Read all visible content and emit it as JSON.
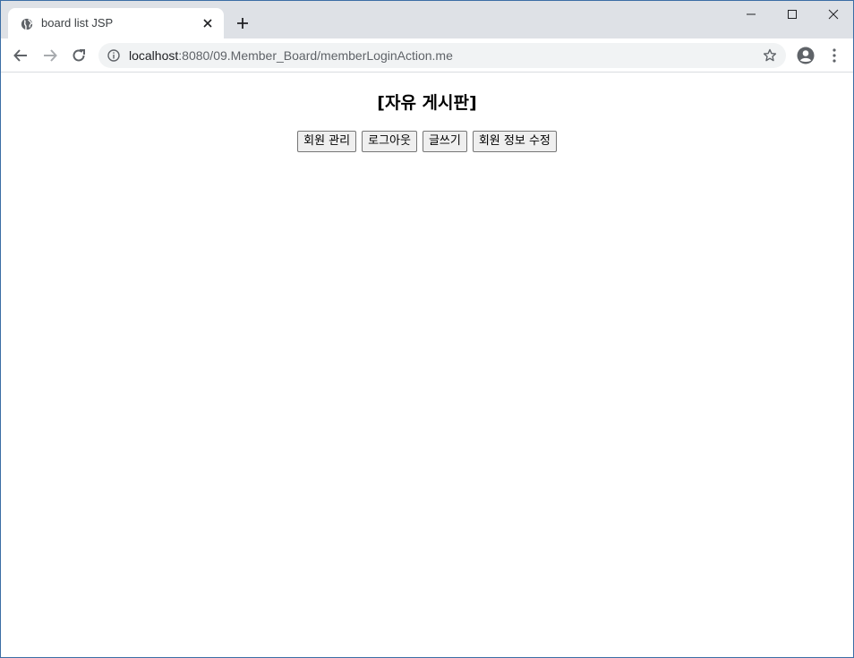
{
  "browser": {
    "tab_title": "board list JSP",
    "url_host": "localhost",
    "url_rest": ":8080/09.Member_Board/memberLoginAction.me"
  },
  "icons": {
    "favicon": "globe-icon",
    "tab_close": "close-icon",
    "new_tab": "plus-icon",
    "back": "arrow-left-icon",
    "forward": "arrow-right-icon",
    "reload": "reload-icon",
    "info": "info-icon",
    "bookmark": "star-icon",
    "profile": "account-circle-icon",
    "menu": "kebab-menu-icon"
  },
  "page": {
    "title": "[자유 게시판]",
    "buttons": {
      "member_manage": "회원 관리",
      "logout": "로그아웃",
      "write": "글쓰기",
      "edit_member": "회원 정보 수정"
    }
  }
}
